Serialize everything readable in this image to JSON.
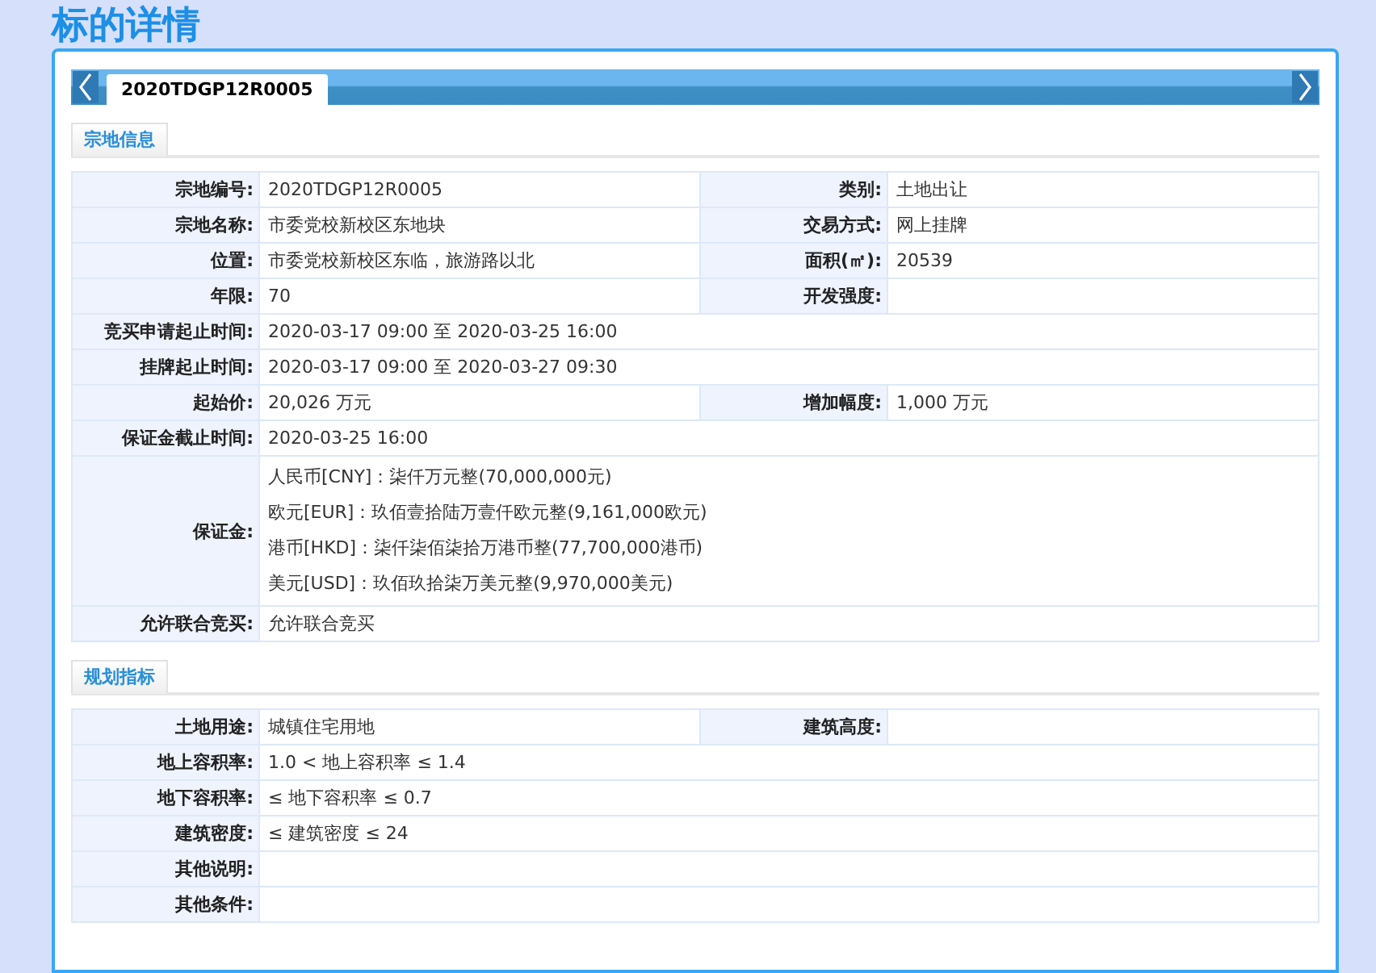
{
  "page_title": "标的详情",
  "tabs": [
    {
      "label": "2020TDGP12R0005",
      "selected": true
    }
  ],
  "sections": [
    {
      "title": "宗地信息",
      "rows": [
        {
          "label": "宗地编号:",
          "value": "2020TDGP12R0005",
          "label2": "类别:",
          "value2": "土地出让"
        },
        {
          "label": "宗地名称:",
          "value": "市委党校新校区东地块",
          "label2": "交易方式:",
          "value2": "网上挂牌"
        },
        {
          "label": "位置:",
          "value": "市委党校新校区东临，旅游路以北",
          "label2": "面积(㎡):",
          "value2": "20539"
        },
        {
          "label": "年限:",
          "value": "70",
          "label2": "开发强度:"
        },
        {
          "label": "竞买申请起止时间:",
          "value": "2020-03-17 09:00 至 2020-03-25 16:00"
        },
        {
          "label": "挂牌起止时间:",
          "value": "2020-03-17 09:00 至 2020-03-27 09:30"
        },
        {
          "label": "起始价:",
          "value": "20,026 万元",
          "label2": "增加幅度:",
          "value2": "1,000 万元"
        },
        {
          "label": "保证金截止时间:",
          "value": "2020-03-25 16:00"
        },
        {
          "label": "保证金:",
          "lines": [
            "人民币[CNY]：柒仟万元整(70,000,000元)",
            "欧元[EUR]：玖佰壹拾陆万壹仟欧元整(9,161,000欧元)",
            "港币[HKD]：柒仟柒佰柒拾万港币整(77,700,000港币)",
            "美元[USD]：玖佰玖拾柒万美元整(9,970,000美元)"
          ]
        },
        {
          "label": "允许联合竞买:",
          "value": "允许联合竞买"
        }
      ]
    },
    {
      "title": "规划指标",
      "rows": [
        {
          "label": "土地用途:",
          "value": "城镇住宅用地",
          "label2": "建筑高度:"
        },
        {
          "label": "地上容积率:",
          "value": "1.0 < 地上容积率 ≤ 1.4"
        },
        {
          "label": "地下容积率:",
          "value": "≤ 地下容积率 ≤ 0.7"
        },
        {
          "label": "建筑密度:",
          "value": "≤ 建筑密度 ≤ 24"
        },
        {
          "label": "其他说明:"
        },
        {
          "label": "其他条件:"
        }
      ]
    }
  ]
}
